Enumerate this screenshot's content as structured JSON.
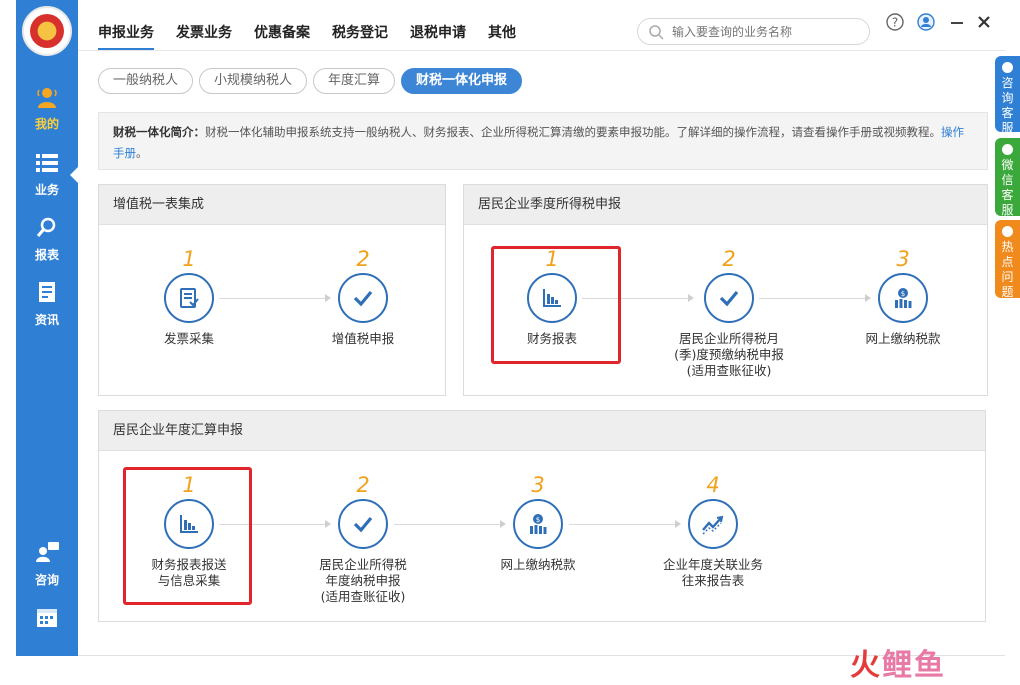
{
  "sidebar": {
    "items": [
      {
        "label": "我的"
      },
      {
        "label": "业务"
      },
      {
        "label": "报表"
      },
      {
        "label": "资讯"
      },
      {
        "label": "咨询"
      }
    ]
  },
  "topnav": [
    "申报业务",
    "发票业务",
    "优惠备案",
    "税务登记",
    "退税申请",
    "其他"
  ],
  "search": {
    "placeholder": "输入要查询的业务名称"
  },
  "subtabs": [
    "一般纳税人",
    "小规模纳税人",
    "年度汇算",
    "财税一体化申报"
  ],
  "intro": {
    "title": "财税一体化简介：",
    "text": "财税一体化辅助申报系统支持一般纳税人、财务报表、企业所得税汇算清缴的要素申报功能。了解详细的操作流程，请查看操作手册或视频教程。",
    "link": "操作手册",
    "end": "。"
  },
  "panels": {
    "vat": {
      "title": "增值税一表集成",
      "steps": [
        {
          "num": "1",
          "label": "发票采集",
          "icon": "document-icon"
        },
        {
          "num": "2",
          "label": "增值税申报",
          "icon": "check-icon"
        }
      ]
    },
    "quarterly": {
      "title": "居民企业季度所得税申报",
      "steps": [
        {
          "num": "1",
          "label": "财务报表",
          "icon": "chart-icon"
        },
        {
          "num": "2",
          "label": "居民企业所得税月\n(季)度预缴纳税申报\n(适用查账征收)",
          "icon": "check-icon"
        },
        {
          "num": "3",
          "label": "网上缴纳税款",
          "icon": "tax-payment-icon"
        }
      ]
    },
    "annual": {
      "title": "居民企业年度汇算申报",
      "steps": [
        {
          "num": "1",
          "label": "财务报表报送\n与信息采集",
          "icon": "chart-icon"
        },
        {
          "num": "2",
          "label": "居民企业所得税\n年度纳税申报\n(适用查账征收)",
          "icon": "check-icon"
        },
        {
          "num": "3",
          "label": "网上缴纳税款",
          "icon": "tax-payment-icon"
        },
        {
          "num": "4",
          "label": "企业年度关联业务\n往来报告表",
          "icon": "trend-icon"
        }
      ]
    }
  },
  "right_tabs": [
    {
      "label": "咨询客服",
      "color": "#2f80d4"
    },
    {
      "label": "微信客服",
      "color": "#3aa83a"
    },
    {
      "label": "热点问题",
      "color": "#f08a1c"
    }
  ],
  "watermark": {
    "part1": "火",
    "part2": "鲤鱼"
  },
  "colors": {
    "sidebar": "#2f80d4",
    "accent_orange": "#f0a21c",
    "highlight_red": "#e0262a"
  }
}
